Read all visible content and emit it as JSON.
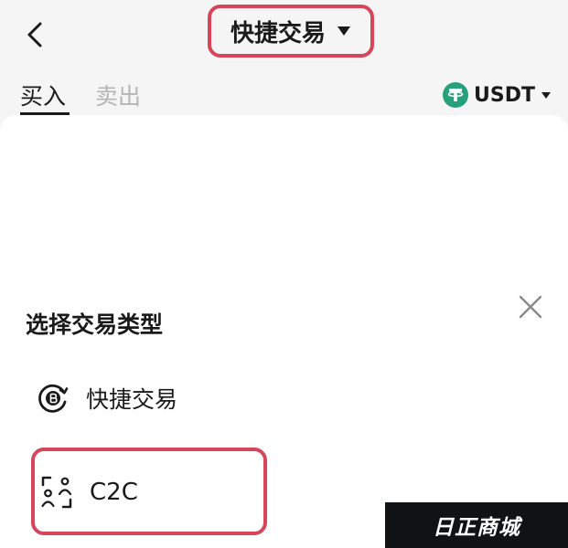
{
  "header": {
    "title": "快捷交易",
    "title_caret": "▼"
  },
  "tabs": [
    {
      "label": "买入",
      "active": true
    },
    {
      "label": "卖出",
      "active": false
    }
  ],
  "currency": {
    "code": "USDT",
    "caret": "▾",
    "icon": "tether-icon",
    "icon_color": "#26a17b"
  },
  "sheet": {
    "title": "选择交易类型",
    "options": [
      {
        "label": "快捷交易",
        "icon": "coin-cycle-icon"
      },
      {
        "label": "C2C",
        "icon": "users-scan-icon"
      }
    ]
  },
  "watermark": {
    "text": "日正商城"
  },
  "colors": {
    "highlight": "#d6455a",
    "page_background": "#f5f5f5",
    "sheet_background": "#ffffff",
    "inactive_tab": "#b5b5b5"
  }
}
